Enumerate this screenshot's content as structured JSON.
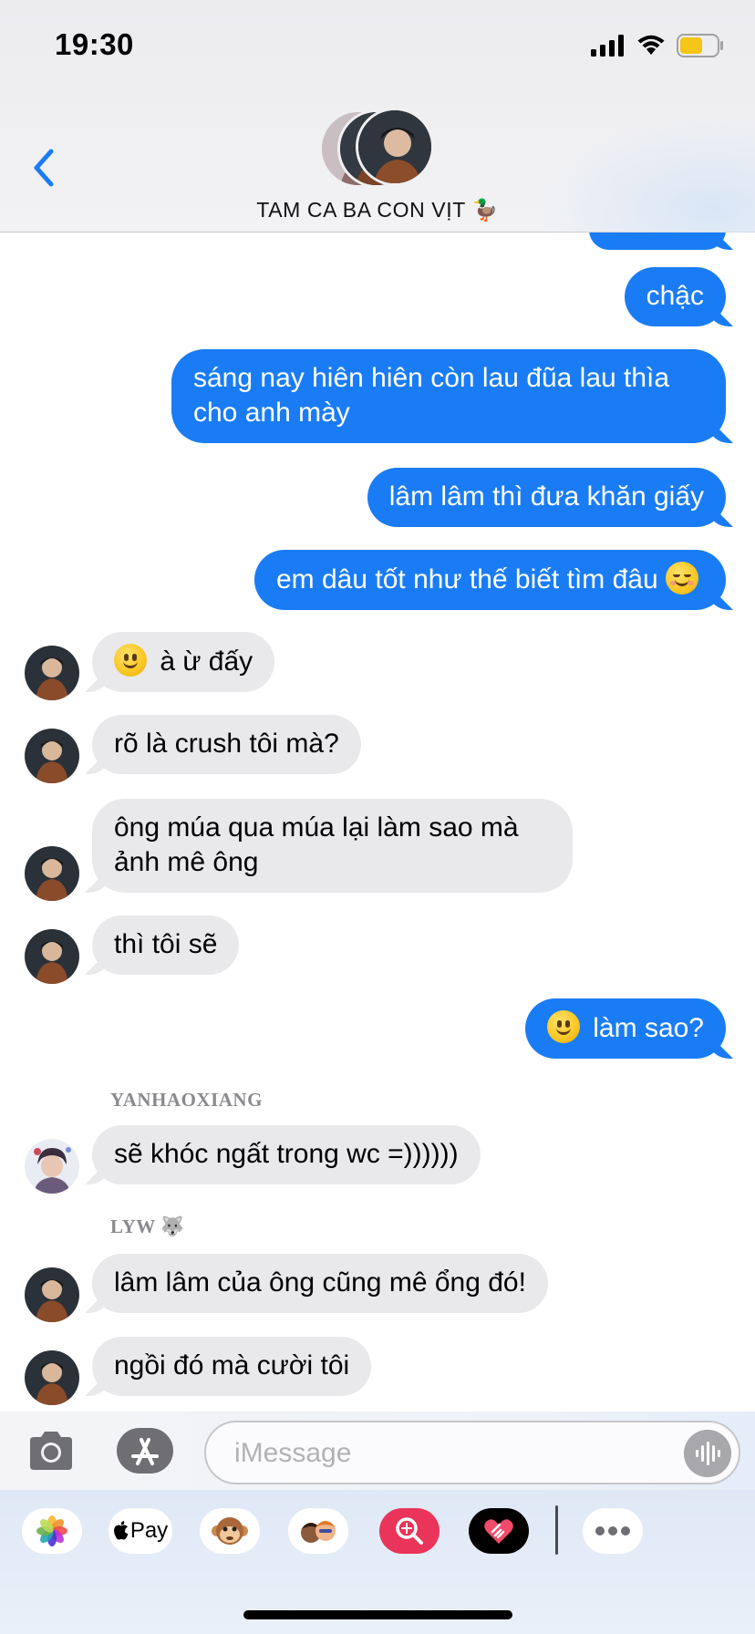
{
  "status_bar": {
    "time": "19:30"
  },
  "header": {
    "title": "TAM CA BA CON VỊT 🦆"
  },
  "messages": [
    {
      "text": ""
    },
    {
      "text": "chậc"
    },
    {
      "text": "sáng nay hiên hiên còn lau đũa lau thìa cho anh mày"
    },
    {
      "text": "lâm lâm thì đưa khăn giấy"
    },
    {
      "text": "em dâu tốt như thế biết tìm đâu"
    },
    {
      "text": "à ừ đấy"
    },
    {
      "text": "rõ là crush tôi mà?"
    },
    {
      "text": "ông múa qua múa lại làm sao mà ảnh mê ông"
    },
    {
      "text": "thì tôi sẽ"
    },
    {
      "text": "làm sao?"
    },
    {
      "sender": "YANHAOXIANG",
      "text": "sẽ khóc ngất trong wc =))))))"
    },
    {
      "sender": "LYW 🐺",
      "text": "lâm lâm của ông cũng mê ổng đó!"
    },
    {
      "text": "ngồi đó mà cười tôi"
    }
  ],
  "input": {
    "placeholder": "iMessage"
  },
  "app_drawer": {
    "items": [
      "photos-icon",
      "apple-pay-icon",
      "monkey-memoji-icon",
      "memoji-stickers-icon",
      "image-search-icon",
      "digital-touch-icon",
      "more-icon"
    ],
    "pay_label": "Pay"
  },
  "colors": {
    "outgoing": "#1a7cf5",
    "incoming": "#e9e9eb",
    "accent": "#1a7cf5"
  }
}
